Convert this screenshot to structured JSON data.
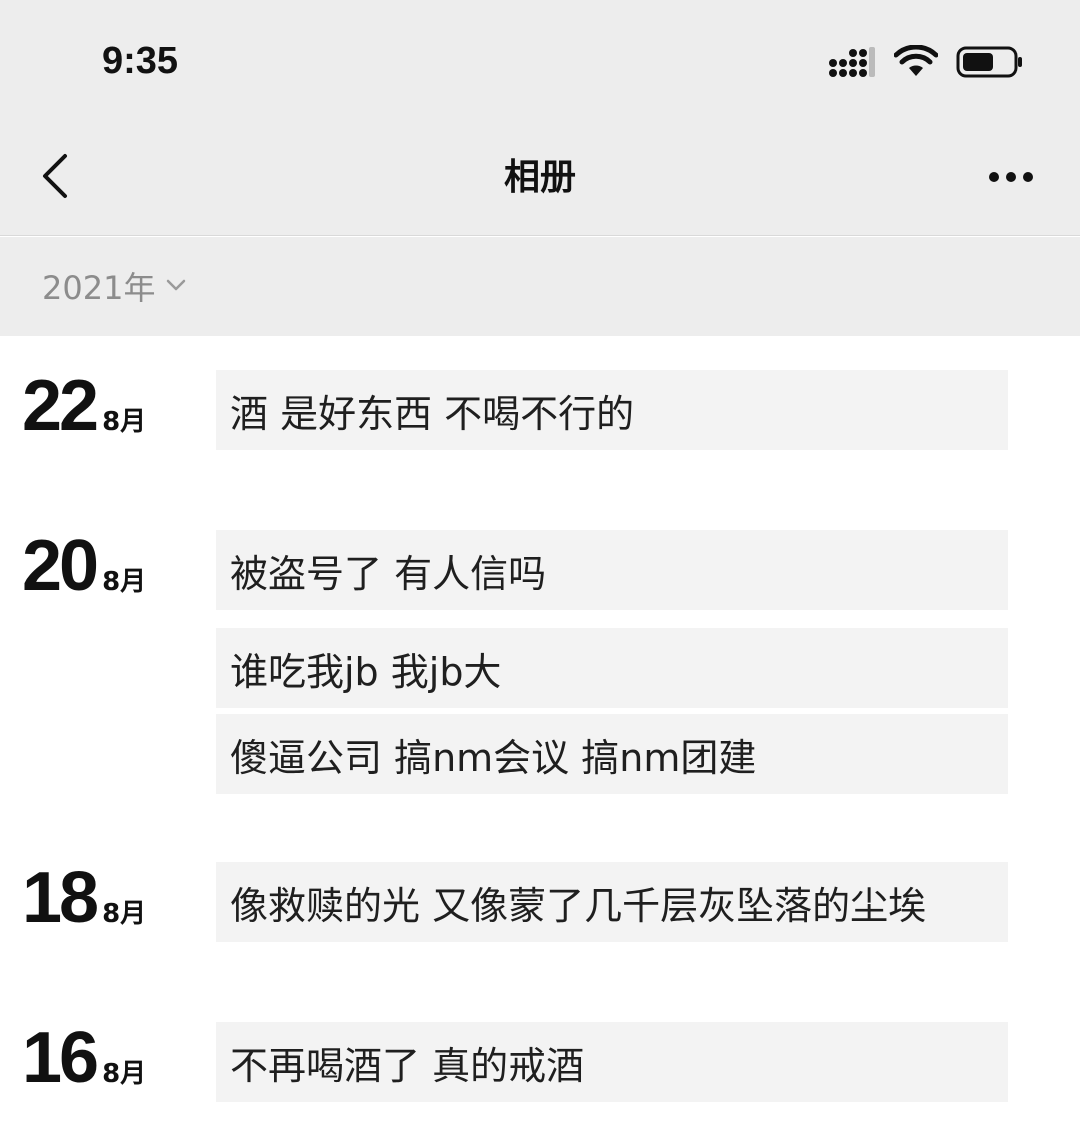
{
  "status_bar": {
    "time": "9:35",
    "icons": [
      "signal-icon",
      "wifi-icon",
      "battery-icon"
    ]
  },
  "nav": {
    "title": "相册",
    "back_icon": "chevron-left-icon",
    "more_icon": "more-dots-icon"
  },
  "year_selector": {
    "label": "2021年",
    "icon": "chevron-down-icon"
  },
  "day_groups": [
    {
      "day": "22",
      "month": "8月",
      "posts": [
        "酒 是好东西 不喝不行的"
      ]
    },
    {
      "day": "20",
      "month": "8月",
      "posts": [
        "被盗号了 有人信吗",
        "谁吃我jb 我jb大",
        "傻逼公司 搞nm会议 搞nm团建"
      ]
    },
    {
      "day": "18",
      "month": "8月",
      "posts": [
        "像救赎的光 又像蒙了几千层灰坠落的尘埃"
      ]
    },
    {
      "day": "16",
      "month": "8月",
      "posts": [
        "不再喝酒了 真的戒酒"
      ]
    }
  ]
}
